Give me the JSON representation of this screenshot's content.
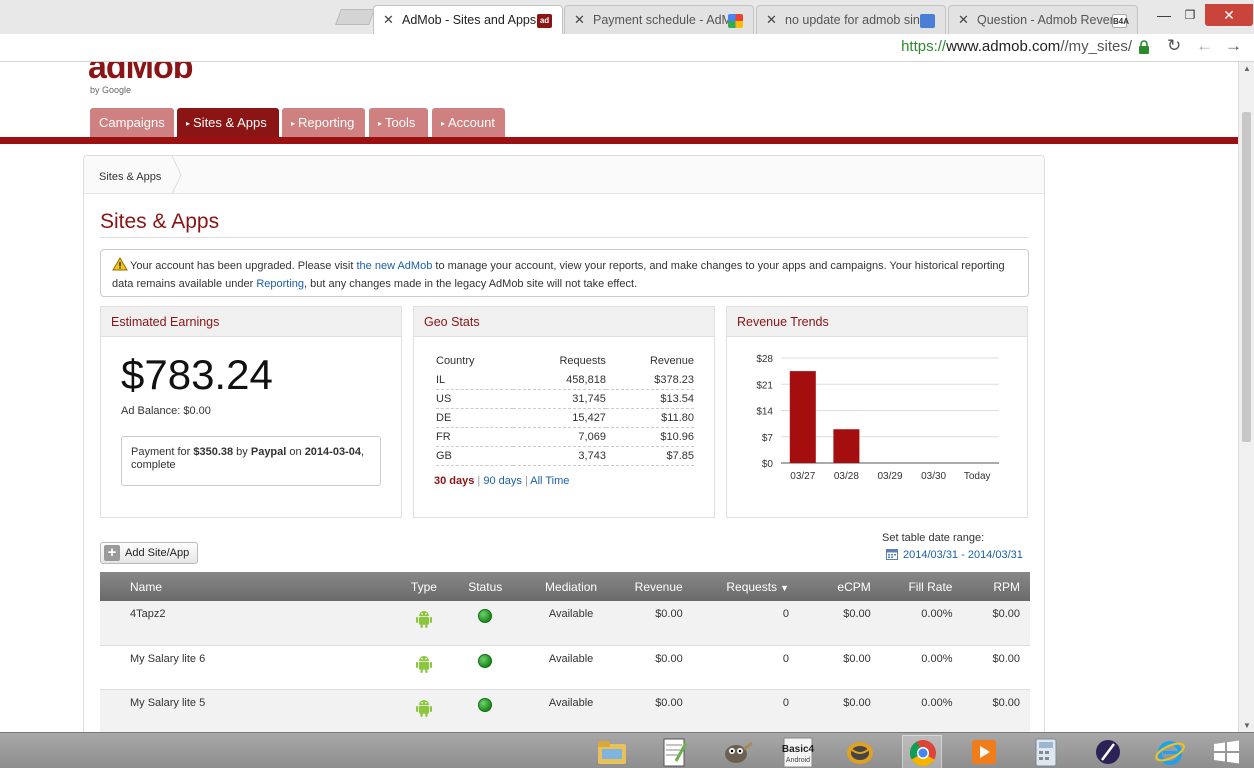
{
  "browser": {
    "tabs": [
      {
        "title": "AdMob - Sites and Apps",
        "favicon": "ad",
        "active": true
      },
      {
        "title": "Payment schedule - AdMob",
        "favicon": "google-icon",
        "active": false
      },
      {
        "title": "no update for admob since",
        "favicon": "forum-icon",
        "active": false
      },
      {
        "title": "Question - Admob Revenue",
        "favicon": "B4A",
        "active": false
      }
    ],
    "url_scheme": "https://",
    "url_host": "www.admob.com",
    "url_path": "//my_sites/"
  },
  "logo": {
    "text": "adMob",
    "byline": "by Google"
  },
  "nav": {
    "tabs": [
      {
        "label": "Campaigns",
        "caret": "",
        "active": false
      },
      {
        "label": "Sites & Apps",
        "caret": "▸",
        "active": true
      },
      {
        "label": "Reporting",
        "caret": "▸",
        "active": false
      },
      {
        "label": "Tools",
        "caret": "▸",
        "active": false
      },
      {
        "label": "Account",
        "caret": "▸",
        "active": false
      }
    ]
  },
  "breadcrumb": "Sites & Apps",
  "page_title": "Sites & Apps",
  "alert": {
    "part1": "Your account has been upgraded. Please visit ",
    "link1": "the new AdMob",
    "part2": " to manage your account, view your reports, and make changes to your apps and campaigns. Your historical reporting data remains available under ",
    "link2": "Reporting",
    "part3": ", but any changes made in the legacy AdMob site will not take effect."
  },
  "earnings": {
    "title": "Estimated Earnings",
    "value": "$783.24",
    "ad_balance": "Ad Balance: $0.00",
    "payment_prefix": "Payment for ",
    "payment_amount": "$350.38",
    "payment_by": " by ",
    "payment_method": "Paypal",
    "payment_on": " on ",
    "payment_date": "2014-03-04",
    "payment_suffix": ", complete"
  },
  "geo": {
    "title": "Geo Stats",
    "headers": [
      "Country",
      "Requests",
      "Revenue"
    ],
    "rows": [
      [
        "IL",
        "458,818",
        "$378.23"
      ],
      [
        "US",
        "31,745",
        "$13.54"
      ],
      [
        "DE",
        "15,427",
        "$11.80"
      ],
      [
        "FR",
        "7,069",
        "$10.96"
      ],
      [
        "GB",
        "3,743",
        "$7.85"
      ]
    ],
    "ranges": [
      "30 days",
      "90 days",
      "All Time"
    ],
    "separator": " | "
  },
  "revenue_trends": {
    "title": "Revenue Trends"
  },
  "chart_data": {
    "type": "bar",
    "categories": [
      "03/27",
      "03/28",
      "03/29",
      "03/30",
      "Today"
    ],
    "values": [
      24.5,
      9,
      0,
      0,
      0
    ],
    "yticks": [
      "$0",
      "$7",
      "$14",
      "$21",
      "$28"
    ],
    "ylim": [
      0,
      28
    ],
    "bar_color": "#a40e0e",
    "grid": true
  },
  "toolbar": {
    "add_label": "Add Site/App",
    "date_label": "Set table date range:",
    "date_range": "2014/03/31 - 2014/03/31"
  },
  "apps_table": {
    "headers": [
      "Name",
      "Type",
      "Status",
      "Mediation",
      "Revenue",
      "Requests",
      "eCPM",
      "Fill Rate",
      "RPM"
    ],
    "sort_caret": "▼",
    "rows": [
      {
        "name": "4Tapz2",
        "type": "android-icon",
        "status": "active",
        "mediation": "Available",
        "revenue": "$0.00",
        "requests": "0",
        "ecpm": "$0.00",
        "fill_rate": "0.00%",
        "rpm": "$0.00"
      },
      {
        "name": "My Salary lite 6",
        "type": "android-icon",
        "status": "active",
        "mediation": "Available",
        "revenue": "$0.00",
        "requests": "0",
        "ecpm": "$0.00",
        "fill_rate": "0.00%",
        "rpm": "$0.00"
      },
      {
        "name": "My Salary lite 5",
        "type": "android-icon",
        "status": "active",
        "mediation": "Available",
        "revenue": "$0.00",
        "requests": "0",
        "ecpm": "$0.00",
        "fill_rate": "0.00%",
        "rpm": "$0.00"
      }
    ]
  },
  "taskbar": {
    "apps": [
      "file-explorer-icon",
      "notepad-plus-icon",
      "gimp-icon",
      "basic4android-icon",
      "sublime-icon",
      "chrome-icon",
      "media-player-icon",
      "calculator-icon",
      "eclipse-icon",
      "internet-explorer-icon",
      "windows-start-icon"
    ],
    "basic_label": "Basic4",
    "android_label": "Android"
  }
}
